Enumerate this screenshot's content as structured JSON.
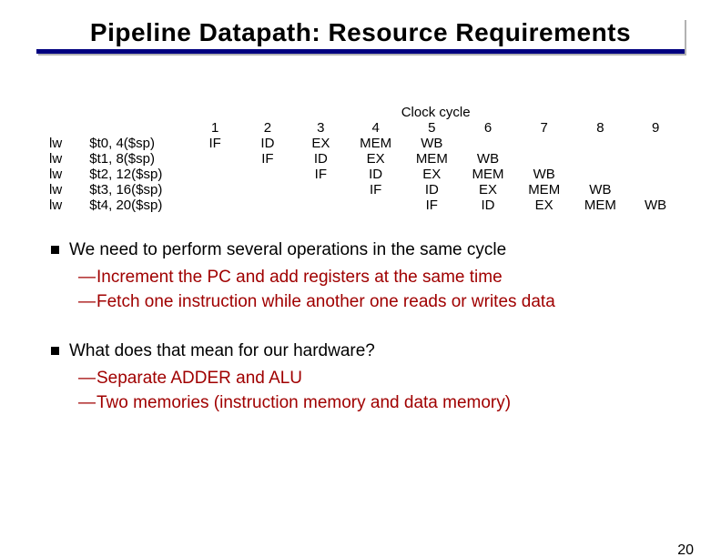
{
  "title": "Pipeline Datapath: Resource Requirements",
  "clock_header": "Clock cycle",
  "cycles": [
    "1",
    "2",
    "3",
    "4",
    "5",
    "6",
    "7",
    "8",
    "9"
  ],
  "rows": [
    {
      "instr": "lw",
      "oper": "$t0, 4($sp)",
      "stages": [
        "IF",
        "ID",
        "EX",
        "MEM",
        "WB",
        "",
        "",
        "",
        ""
      ]
    },
    {
      "instr": "lw",
      "oper": "$t1, 8($sp)",
      "stages": [
        "",
        "IF",
        "ID",
        "EX",
        "MEM",
        "WB",
        "",
        "",
        ""
      ]
    },
    {
      "instr": "lw",
      "oper": "$t2, 12($sp)",
      "stages": [
        "",
        "",
        "IF",
        "ID",
        "EX",
        "MEM",
        "WB",
        "",
        ""
      ]
    },
    {
      "instr": "lw",
      "oper": "$t3, 16($sp)",
      "stages": [
        "",
        "",
        "",
        "IF",
        "ID",
        "EX",
        "MEM",
        "WB",
        ""
      ]
    },
    {
      "instr": "lw",
      "oper": "$t4, 20($sp)",
      "stages": [
        "",
        "",
        "",
        "",
        "IF",
        "ID",
        "EX",
        "MEM",
        "WB"
      ]
    }
  ],
  "bullet1": "We need to perform several operations in the same cycle",
  "bullet1_sub1": "Increment the PC and add registers at the same time",
  "bullet1_sub2": "Fetch one instruction while another one reads or writes data",
  "bullet2": "What does that mean for our hardware?",
  "bullet2_sub1": "Separate ADDER and ALU",
  "bullet2_sub2": "Two memories (instruction memory and data memory)",
  "page_number": "20"
}
